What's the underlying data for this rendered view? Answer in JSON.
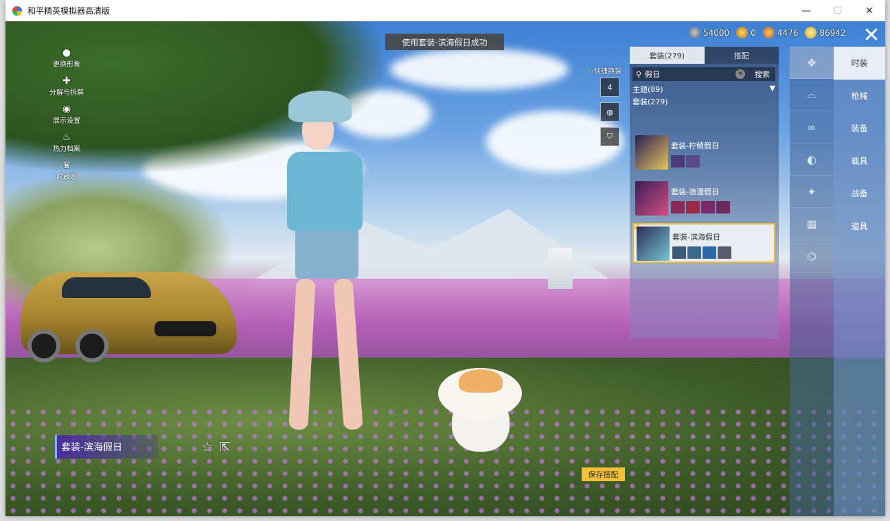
{
  "window": {
    "title": "和平精英模拟器高清版",
    "minimize": "—",
    "maximize": "☐",
    "close": "✕"
  },
  "toast": "使用套装-滨海假日成功",
  "currency": [
    {
      "icon": "silver-coin-icon",
      "value": "54000"
    },
    {
      "icon": "gold-coin-icon",
      "value": "0"
    },
    {
      "icon": "bronze-medal-icon",
      "value": "4476"
    },
    {
      "icon": "diamond-icon",
      "value": "86942"
    }
  ],
  "left_menu": [
    {
      "label": "更换形象",
      "icon": "person-icon"
    },
    {
      "label": "分解与拆解",
      "icon": "puzzle-icon"
    },
    {
      "label": "展示设置",
      "icon": "eye-icon"
    },
    {
      "label": "热力档案",
      "icon": "flame-icon"
    },
    {
      "label": "收藏家",
      "icon": "trophy-icon"
    }
  ],
  "quick_switch": {
    "label": "快捷换装",
    "badge": "4"
  },
  "outfit_panel": {
    "tabs": [
      {
        "label": "套装(279)",
        "active": true
      },
      {
        "label": "搭配",
        "active": false
      }
    ],
    "search": {
      "value": "假日",
      "button": "搜索"
    },
    "group": {
      "label": "主题(89)",
      "caret": "▼"
    },
    "subgroup": "套装(279)",
    "outfits": [
      {
        "name": "套装-柠萌假日",
        "selected": false
      },
      {
        "name": "套装-浪漫假日",
        "selected": false
      },
      {
        "name": "套装-滨海假日",
        "selected": true
      }
    ]
  },
  "categories": [
    {
      "label": "时装",
      "active": true
    },
    {
      "label": "枪械",
      "active": false
    },
    {
      "label": "装备",
      "active": false
    },
    {
      "label": "载具",
      "active": false
    },
    {
      "label": "战备",
      "active": false
    },
    {
      "label": "道具",
      "active": false
    }
  ],
  "current_outfit": "套装-滨海假日",
  "save_button": "保存搭配",
  "colors": {
    "accent": "#f3c23a",
    "selected_border": "#f3b92b"
  }
}
